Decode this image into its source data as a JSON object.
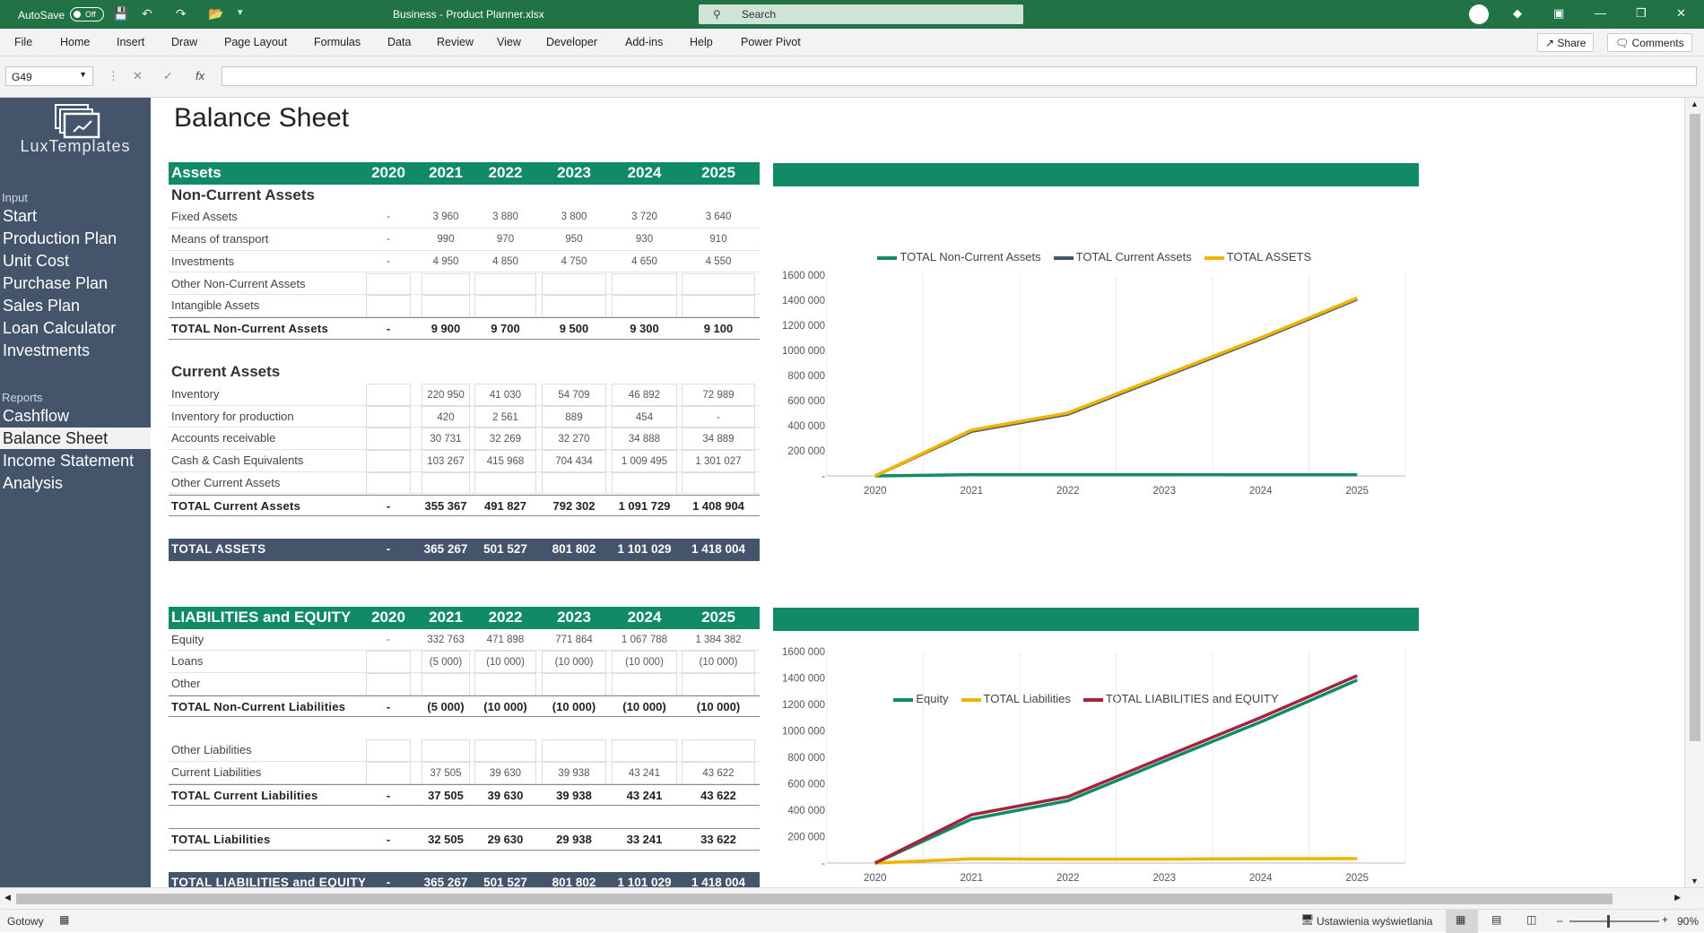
{
  "titlebar": {
    "autosave": "AutoSave",
    "toggle": "Off",
    "title": "Business - Product Planner.xlsx",
    "search": "Search"
  },
  "menu": [
    "File",
    "Home",
    "Insert",
    "Draw",
    "Page Layout",
    "Formulas",
    "Data",
    "Review",
    "View",
    "Developer",
    "Add-ins",
    "Help",
    "Power Pivot"
  ],
  "share": "Share",
  "comments": "Comments",
  "namebox": "G49",
  "sidebar": {
    "logo": "LuxTemplates",
    "input_label": "Input",
    "input_items": [
      "Start",
      "Production Plan",
      "Unit Cost",
      "Purchase Plan",
      "Sales Plan",
      "Loan Calculator",
      "Investments"
    ],
    "reports_label": "Reports",
    "report_items": [
      "Cashflow",
      "Balance Sheet",
      "Income Statement",
      "Analysis"
    ]
  },
  "page_title": "Balance Sheet",
  "years": [
    "2020",
    "2021",
    "2022",
    "2023",
    "2024",
    "2025"
  ],
  "assets": {
    "header": "Assets",
    "noncurrent_title": "Non-Current Assets",
    "noncurrent_rows": [
      {
        "label": "Fixed Assets",
        "v": [
          "-",
          "3 960",
          "3 880",
          "3 800",
          "3 720",
          "3 640"
        ]
      },
      {
        "label": "Means of transport",
        "v": [
          "-",
          "990",
          "970",
          "950",
          "930",
          "910"
        ]
      },
      {
        "label": "Investments",
        "v": [
          "-",
          "4 950",
          "4 850",
          "4 750",
          "4 650",
          "4 550"
        ]
      },
      {
        "label": "Other Non-Current Assets",
        "v": [
          "",
          "",
          "",
          "",
          "",
          ""
        ]
      },
      {
        "label": "Intangible Assets",
        "v": [
          "",
          "",
          "",
          "",
          "",
          ""
        ]
      }
    ],
    "noncurrent_total": {
      "label": "TOTAL Non-Current Assets",
      "v": [
        "-",
        "9 900",
        "9 700",
        "9 500",
        "9 300",
        "9 100"
      ]
    },
    "current_title": "Current Assets",
    "current_rows": [
      {
        "label": "Inventory",
        "v": [
          "",
          "220 950",
          "41 030",
          "54 709",
          "46 892",
          "72 989"
        ]
      },
      {
        "label": "Inventory for production",
        "v": [
          "",
          "420",
          "2 561",
          "889",
          "454",
          "-"
        ]
      },
      {
        "label": "Accounts receivable",
        "v": [
          "",
          "30 731",
          "32 269",
          "32 270",
          "34 888",
          "34 889"
        ]
      },
      {
        "label": "Cash & Cash Equivalents",
        "v": [
          "",
          "103 267",
          "415 968",
          "704 434",
          "1 009 495",
          "1 301 027"
        ]
      },
      {
        "label": "Other Current Assets",
        "v": [
          "",
          "",
          "",
          "",
          "",
          ""
        ]
      }
    ],
    "current_total": {
      "label": "TOTAL Current Assets",
      "v": [
        "-",
        "355 367",
        "491 827",
        "792 302",
        "1 091 729",
        "1 408 904"
      ]
    },
    "total": {
      "label": "TOTAL ASSETS",
      "v": [
        "-",
        "365 267",
        "501 527",
        "801 802",
        "1 101 029",
        "1 418 004"
      ]
    }
  },
  "liabilities": {
    "header": "LIABILITIES and EQUITY",
    "rows1": [
      {
        "label": "Equity",
        "v": [
          "-",
          "332 763",
          "471 898",
          "771 864",
          "1 067 788",
          "1 384 382"
        ]
      },
      {
        "label": "Loans",
        "v": [
          "",
          "(5 000)",
          "(10 000)",
          "(10 000)",
          "(10 000)",
          "(10 000)"
        ]
      },
      {
        "label": "Other",
        "v": [
          "",
          "",
          "",
          "",
          "",
          ""
        ]
      }
    ],
    "noncurrent_total": {
      "label": "TOTAL Non-Current Liabilities",
      "v": [
        "-",
        "(5 000)",
        "(10 000)",
        "(10 000)",
        "(10 000)",
        "(10 000)"
      ]
    },
    "rows2": [
      {
        "label": "Other Liabilities",
        "v": [
          "",
          "",
          "",
          "",
          "",
          ""
        ]
      },
      {
        "label": "Current Liabilities",
        "v": [
          "",
          "37 505",
          "39 630",
          "39 938",
          "43 241",
          "43 622"
        ]
      }
    ],
    "current_total": {
      "label": "TOTAL Current Liabilities",
      "v": [
        "-",
        "37 505",
        "39 630",
        "39 938",
        "43 241",
        "43 622"
      ]
    },
    "total_liab": {
      "label": "TOTAL Liabilities",
      "v": [
        "-",
        "32 505",
        "29 630",
        "29 938",
        "33 241",
        "33 622"
      ]
    },
    "grand": {
      "label": "TOTAL LIABILITIES and EQUITY",
      "v": [
        "-",
        "365 267",
        "501 527",
        "801 802",
        "1 101 029",
        "1 418 004"
      ]
    }
  },
  "chart_data": [
    {
      "type": "line",
      "x": [
        "2020",
        "2021",
        "2022",
        "2023",
        "2024",
        "2025"
      ],
      "ylim": [
        0,
        1600000
      ],
      "yticks": [
        "-",
        "200 000",
        "400 000",
        "600 000",
        "800 000",
        "1000 000",
        "1200 000",
        "1400 000",
        "1600 000"
      ],
      "legend": "top",
      "series": [
        {
          "name": "TOTAL Non-Current Assets",
          "color": "#108a67",
          "values": [
            0,
            9900,
            9700,
            9500,
            9300,
            9100
          ]
        },
        {
          "name": "TOTAL Current Assets",
          "color": "#44546a",
          "values": [
            0,
            355367,
            491827,
            792302,
            1091729,
            1408904
          ]
        },
        {
          "name": "TOTAL ASSETS",
          "color": "#f0b400",
          "values": [
            0,
            365267,
            501527,
            801802,
            1101029,
            1418004
          ]
        }
      ]
    },
    {
      "type": "line",
      "x": [
        "2020",
        "2021",
        "2022",
        "2023",
        "2024",
        "2025"
      ],
      "ylim": [
        0,
        1600000
      ],
      "yticks": [
        "-",
        "200 000",
        "400 000",
        "600 000",
        "800 000",
        "1000 000",
        "1200 000",
        "1400 000",
        "1600 000"
      ],
      "legend": "top",
      "series": [
        {
          "name": "Equity",
          "color": "#108a67",
          "values": [
            0,
            332763,
            471898,
            771864,
            1067788,
            1384382
          ]
        },
        {
          "name": "TOTAL Liabilities",
          "color": "#f0b400",
          "values": [
            0,
            32505,
            29630,
            29938,
            33241,
            33622
          ]
        },
        {
          "name": "TOTAL LIABILITIES and EQUITY",
          "color": "#a3253c",
          "values": [
            0,
            365267,
            501527,
            801802,
            1101029,
            1418004
          ]
        }
      ]
    }
  ],
  "status": {
    "ready": "Gotowy",
    "display": "Ustawienia wyświetlania",
    "zoom": "90%"
  }
}
